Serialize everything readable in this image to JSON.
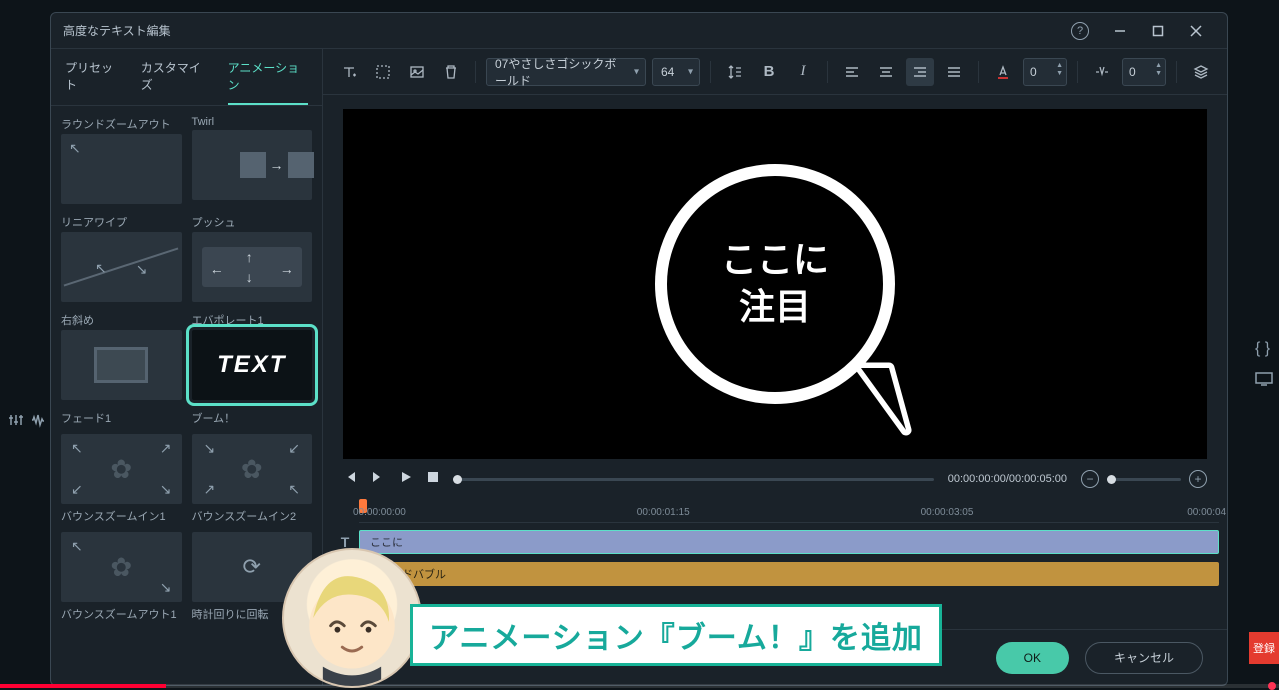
{
  "window": {
    "title": "高度なテキスト編集"
  },
  "tabs": {
    "preset": "プリセット",
    "customize": "カスタマイズ",
    "animation": "アニメーション"
  },
  "presets": [
    {
      "label": "ラウンドズームアウト"
    },
    {
      "label": "Twirl"
    },
    {
      "label": "リニアワイプ"
    },
    {
      "label": "プッシュ"
    },
    {
      "label": "右斜め"
    },
    {
      "label": "エバポレート1"
    },
    {
      "label": "フェード1"
    },
    {
      "label": "ブーム！",
      "thumb_text": "TEXT",
      "selected": true
    },
    {
      "label": "バウンスズームイン1"
    },
    {
      "label": "バウンスズームイン2"
    },
    {
      "label": "バウンスズームアウト1"
    },
    {
      "label": "時計回りに回転"
    }
  ],
  "toolbar": {
    "font": "07やさしさゴシックボールド",
    "size": "64",
    "char_spacing": "0",
    "line_spacing": "0"
  },
  "preview": {
    "line1": "ここに",
    "line2": "注目"
  },
  "transport": {
    "time": "00:00:00:00/00:00:05:00"
  },
  "ruler": {
    "labels": [
      "00:00:00:00",
      "00:00:01:15",
      "00:00:03:05",
      "00:00:04"
    ]
  },
  "tracks": {
    "text": "ここに",
    "shape": "ラウンドバブル"
  },
  "footer": {
    "ok": "OK",
    "cancel": "キャンセル"
  },
  "overlay": "アニメーション『ブーム！』を追加",
  "subscribe": "登録"
}
